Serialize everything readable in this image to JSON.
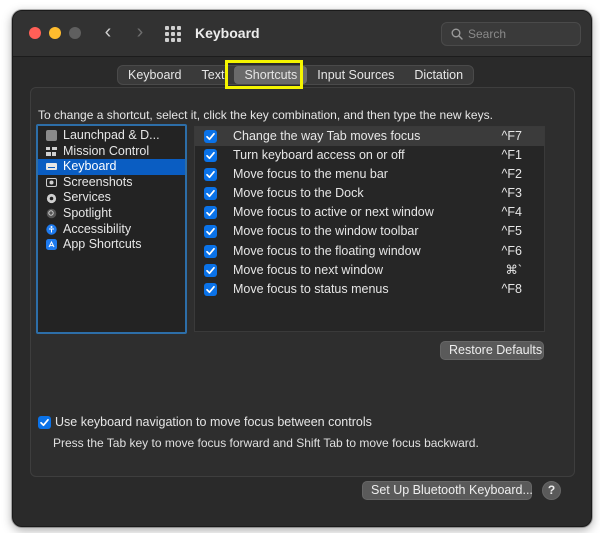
{
  "window": {
    "title": "Keyboard",
    "nav_back": "‹",
    "nav_forward": "›"
  },
  "search": {
    "placeholder": "Search",
    "value": ""
  },
  "tabs": [
    {
      "label": "Keyboard",
      "active": false
    },
    {
      "label": "Text",
      "active": false
    },
    {
      "label": "Shortcuts",
      "active": true
    },
    {
      "label": "Input Sources",
      "active": false
    },
    {
      "label": "Dictation",
      "active": false
    }
  ],
  "instructions": "To change a shortcut, select it, click the key combination, and then type the new keys.",
  "categories": [
    {
      "label": "Launchpad & D...",
      "icon": "launchpad-icon",
      "selected": false
    },
    {
      "label": "Mission Control",
      "icon": "mission-control-icon",
      "selected": false
    },
    {
      "label": "Keyboard",
      "icon": "keyboard-icon",
      "selected": true
    },
    {
      "label": "Screenshots",
      "icon": "screenshots-icon",
      "selected": false
    },
    {
      "label": "Services",
      "icon": "gear-icon",
      "selected": false
    },
    {
      "label": "Spotlight",
      "icon": "spotlight-icon",
      "selected": false
    },
    {
      "label": "Accessibility",
      "icon": "accessibility-icon",
      "selected": false
    },
    {
      "label": "App Shortcuts",
      "icon": "app-store-icon",
      "selected": false
    }
  ],
  "shortcuts": [
    {
      "label": "Change the way Tab moves focus",
      "key": "^F7",
      "checked": true,
      "selected": true
    },
    {
      "label": "Turn keyboard access on or off",
      "key": "^F1",
      "checked": true,
      "selected": false
    },
    {
      "label": "Move focus to the menu bar",
      "key": "^F2",
      "checked": true,
      "selected": false
    },
    {
      "label": "Move focus to the Dock",
      "key": "^F3",
      "checked": true,
      "selected": false
    },
    {
      "label": "Move focus to active or next window",
      "key": "^F4",
      "checked": true,
      "selected": false
    },
    {
      "label": "Move focus to the window toolbar",
      "key": "^F5",
      "checked": true,
      "selected": false
    },
    {
      "label": "Move focus to the floating window",
      "key": "^F6",
      "checked": true,
      "selected": false
    },
    {
      "label": "Move focus to next window",
      "key": "⌘`",
      "checked": true,
      "selected": false
    },
    {
      "label": "Move focus to status menus",
      "key": "^F8",
      "checked": true,
      "selected": false
    }
  ],
  "restore_defaults": "Restore Defaults",
  "keyboard_navigation": {
    "label": "Use keyboard navigation to move focus between controls",
    "checked": true,
    "hint": "Press the Tab key to move focus forward and Shift Tab to move focus backward."
  },
  "bluetooth_button": "Set Up Bluetooth Keyboard...",
  "help_button": "?",
  "colors": {
    "accent": "#0a72e8",
    "selection": "#0a5dc2",
    "highlight_box": "#f5f500",
    "window_bg": "#2a2a2a"
  }
}
